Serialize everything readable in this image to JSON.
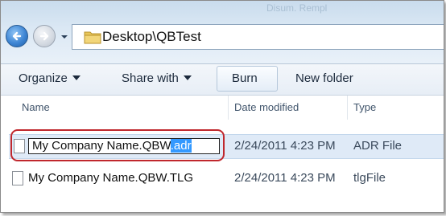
{
  "window": {
    "ghost_title": "Disum. Rempl"
  },
  "address": {
    "path": "Desktop\\QBTest"
  },
  "toolbar": {
    "organize_label": "Organize",
    "share_label": "Share with",
    "burn_label": "Burn",
    "new_folder_label": "New folder"
  },
  "columns": {
    "name": "Name",
    "date": "Date modified",
    "type": "Type"
  },
  "files": [
    {
      "name_base": "My Company Name.QBW",
      "name_ext_selected": ".adr",
      "date": "2/24/2011 4:23 PM",
      "type": "ADR File",
      "editing": true
    },
    {
      "name": "My Company Name.QBW.TLG",
      "date": "2/24/2011 4:23 PM",
      "type": "tlgFile",
      "editing": false
    }
  ],
  "colors": {
    "highlight_ring": "#c0272d",
    "selection": "#3399ff",
    "row_selected": "#dfeaf7"
  },
  "icons": {
    "back": "back-arrow-icon",
    "forward": "forward-arrow-icon",
    "recent": "chevron-down-icon",
    "folder": "folder-icon",
    "file": "file-icon"
  }
}
